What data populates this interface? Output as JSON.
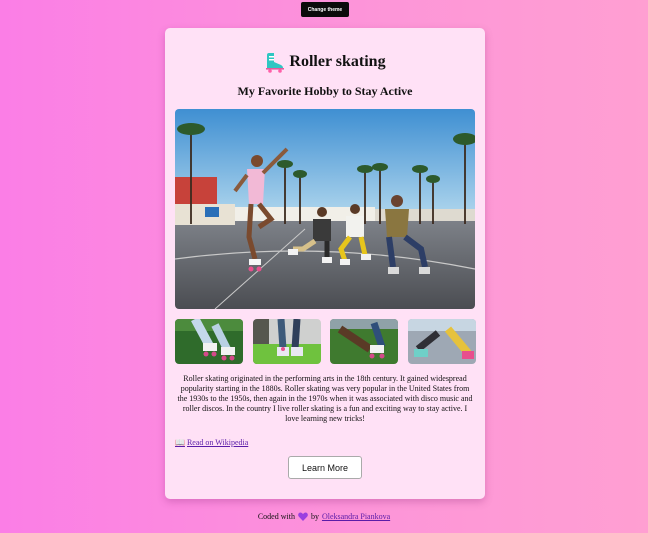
{
  "theme_button": {
    "label": "Change theme"
  },
  "card": {
    "title": "Roller skating",
    "title_icon": "roller-skate-icon",
    "subtitle": "My Favorite Hobby to Stay Active",
    "hero_image": "group-of-roller-skaters-on-boardwalk",
    "thumbnails": [
      "skates-on-grass",
      "skater-legs-by-wall",
      "skater-kneeling-on-grass",
      "skates-on-pavement"
    ],
    "description": "Roller skating originated in the performing arts in the 18th century. It gained widespread popularity starting in the 1880s. Roller skating was very popular in the United States from the 1930s to the 1950s, then again in the 1970s when it was associated with disco music and roller discos. In the country I live roller skating is a fun and exciting way to stay active. I love learning new tricks!",
    "wiki_link": "Read on Wikipedia",
    "wiki_icon": "book-icon",
    "learn_more_label": "Learn More"
  },
  "footer": {
    "prefix": "Coded with",
    "heart_icon": "purple-heart-icon",
    "by": "by",
    "author": "Oleksandra Piankova"
  },
  "colors": {
    "background_left": "#fb7ee6",
    "background_right": "#ff9fd2",
    "card": "#ffe1f6",
    "link": "#5a1ca8"
  }
}
